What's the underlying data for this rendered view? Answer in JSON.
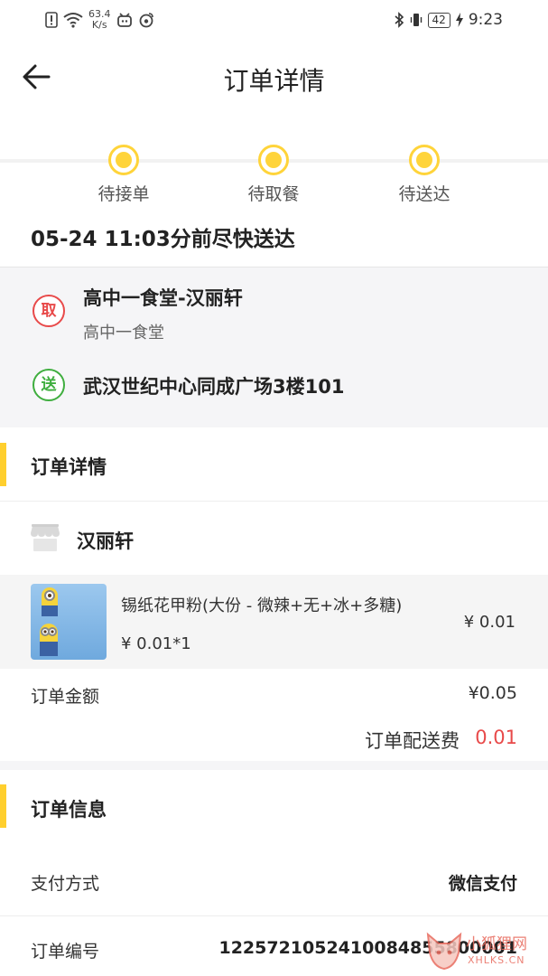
{
  "status_bar": {
    "net_speed": "63.4",
    "net_unit": "K/s",
    "battery": "42",
    "time": "9:23"
  },
  "header": {
    "title": "订单详情"
  },
  "progress": {
    "steps": [
      {
        "label": "待接单"
      },
      {
        "label": "待取餐"
      },
      {
        "label": "待送达"
      }
    ],
    "accent_color": "#ffd43a"
  },
  "delivery": {
    "time_text": "05-24 11:03分前尽快送达"
  },
  "pickup": {
    "badge": "取",
    "shop_name": "高中一食堂-汉丽轩",
    "shop_sub": "高中一食堂"
  },
  "dropoff": {
    "badge": "送",
    "address": "武汉世纪中心同成广场3楼101"
  },
  "order_details": {
    "section_title": "订单详情",
    "store_name": "汉丽轩",
    "items": [
      {
        "name": "锡纸花甲粉(大份 - 微辣+无+冰+多糖)",
        "unit_price_qty": "¥ 0.01*1",
        "price": "¥ 0.01"
      }
    ],
    "amount_label": "订单金额",
    "amount_value": "¥0.05",
    "fee_label": "订单配送费",
    "fee_value": "0.01"
  },
  "order_info": {
    "section_title": "订单信息",
    "payment_label": "支付方式",
    "payment_value": "微信支付",
    "order_no_label": "订单编号",
    "order_no_value": "1225721052410084855800001"
  },
  "watermark": {
    "text": "小狐狸网",
    "sub": "XHLKS.CN"
  },
  "colors": {
    "accent": "#ffcf2e",
    "red": "#e84a4a",
    "green": "#3fae3f"
  }
}
